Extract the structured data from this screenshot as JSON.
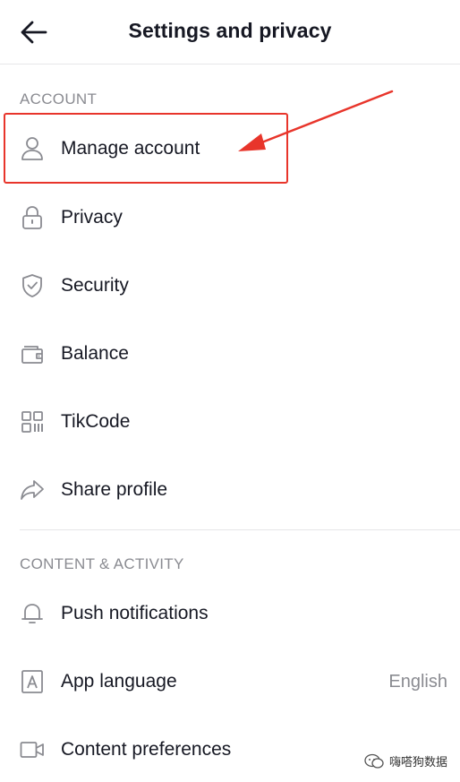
{
  "header": {
    "title": "Settings and privacy"
  },
  "sections": {
    "account": {
      "label": "ACCOUNT",
      "items": [
        {
          "label": "Manage account",
          "icon": "person-icon"
        },
        {
          "label": "Privacy",
          "icon": "lock-icon"
        },
        {
          "label": "Security",
          "icon": "shield-icon"
        },
        {
          "label": "Balance",
          "icon": "wallet-icon"
        },
        {
          "label": "TikCode",
          "icon": "qr-code-icon"
        },
        {
          "label": "Share profile",
          "icon": "share-arrow-icon"
        }
      ]
    },
    "content": {
      "label": "CONTENT & ACTIVITY",
      "items": [
        {
          "label": "Push notifications",
          "icon": "bell-icon"
        },
        {
          "label": "App language",
          "icon": "language-icon",
          "value": "English"
        },
        {
          "label": "Content preferences",
          "icon": "video-camera-icon"
        }
      ]
    }
  },
  "annotation": {
    "color": "#e8352b",
    "highlighted_item": "Manage account"
  },
  "watermark": {
    "text": "嗨嗒狗数据"
  }
}
